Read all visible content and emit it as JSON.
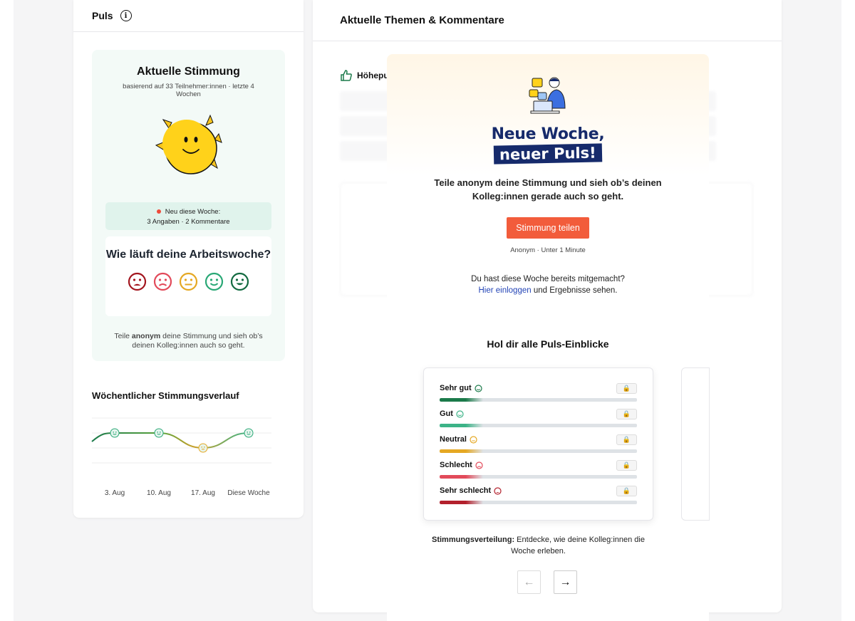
{
  "left": {
    "title": "Puls",
    "mood_title": "Aktuelle Stimmung",
    "mood_sub": "basierend auf 33 Teilnehmer:innen · letzte 4 Wochen",
    "new_title": "Neu diese Woche:",
    "new_detail": "3 Angaben · 2 Kommentare",
    "question": "Wie läuft deine Arbeitswoche?",
    "teil_pre": "Teile ",
    "teil_bold": "anonym",
    "teil_post": " deine Stimmung und sieh ob’s deinen Kolleg:innen auch so geht.",
    "weekly_title": "Wöchentlicher Stimmungsverlauf",
    "weeks": [
      "3. Aug",
      "10. Aug",
      "17. Aug",
      "Diese Woche"
    ]
  },
  "chart_data": {
    "type": "line",
    "title": "Wöchentlicher Stimmungsverlauf",
    "categories": [
      "3. Aug",
      "10. Aug",
      "17. Aug",
      "Diese Woche"
    ],
    "values": [
      "Gut",
      "Gut",
      "Neutral",
      "Gut"
    ]
  },
  "right": {
    "title": "Aktuelle Themen & Kommentare",
    "section": "Höhepu"
  },
  "modal": {
    "headline1": "Neue Woche,",
    "headline2": "neuer Puls!",
    "text": "Teile anonym deine Stimmung und sieh ob’s deinen Kolleg:innen gerade auch so geht.",
    "cta": "Stimmung teilen",
    "anon": "Anonym · Unter 1 Minute",
    "already": "Du hast diese Woche bereits mitgemacht?",
    "login_link": "Hier einloggen",
    "login_post": " und Ergebnisse sehen.",
    "insights_title": "Hol dir alle Puls-Einblicke",
    "rows": [
      {
        "label": "Sehr gut",
        "color": "#1b7a4a"
      },
      {
        "label": "Gut",
        "color": "#3cb387"
      },
      {
        "label": "Neutral",
        "color": "#e5a823"
      },
      {
        "label": "Schlecht",
        "color": "#e24a5a"
      },
      {
        "label": "Sehr schlecht",
        "color": "#b3202c"
      }
    ],
    "caption_bold": "Stimmungsverteilung:",
    "caption_rest": " Entdecke, wie deine Kolleg:innen die Woche erleben.",
    "prev": "←",
    "next": "→"
  }
}
